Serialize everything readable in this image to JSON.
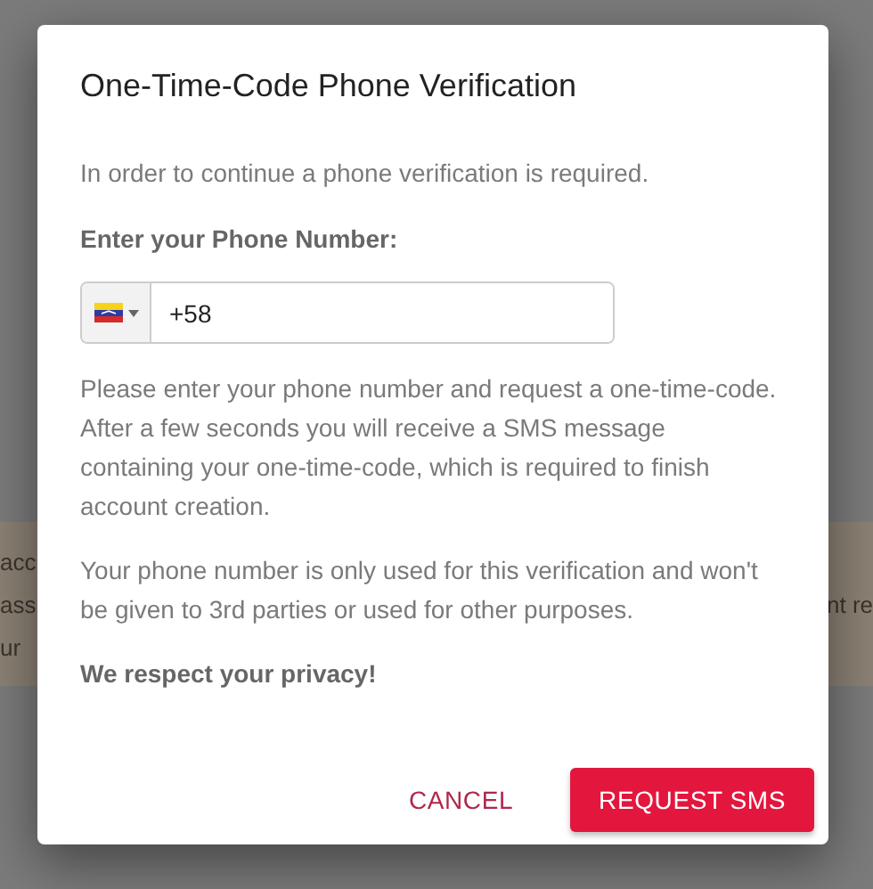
{
  "background": {
    "banner_left_lines": [
      "acc",
      "ass",
      "ur"
    ],
    "banner_right_lines": [
      "nt re"
    ]
  },
  "dialog": {
    "title": "One-Time-Code Phone Verification",
    "intro": "In order to continue a phone verification is required.",
    "phone_label": "Enter your Phone Number:",
    "phone_field": {
      "value": "+58"
    },
    "instructions": "Please enter your phone number and request a one-time-code. After a few seconds you will receive a SMS message containing your one-time-code, which is required to finish account creation.",
    "privacy_note": "Your phone number is only used for this verification and won't be given to 3rd parties or used for other purposes.",
    "privacy_slogan": "We respect your privacy!",
    "buttons": [
      {
        "label": "CANCEL",
        "kind": "text"
      },
      {
        "label": "REQUEST SMS",
        "kind": "primary"
      }
    ]
  }
}
